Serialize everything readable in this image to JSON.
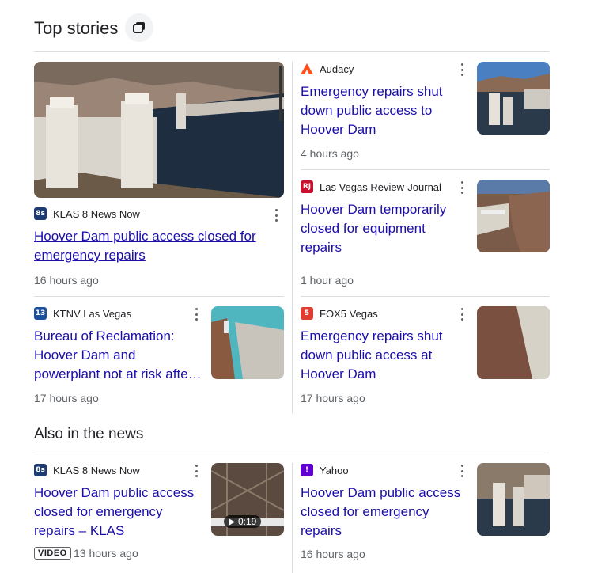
{
  "top_stories": {
    "title": "Top stories",
    "cards": [
      {
        "source": "KLAS 8 News Now",
        "logo_text": "8s",
        "logo_color": "#1f3b73",
        "headline": "Hoover Dam public access closed for emergency repairs",
        "time": "16 hours ago"
      },
      {
        "source": "Audacy",
        "logo_text": "",
        "logo_color": "#ff4f1f",
        "headline": "Emergency repairs shut down public access to Hoover Dam",
        "time": "4 hours ago"
      },
      {
        "source": "Las Vegas Review-Journal",
        "logo_text": "RJ",
        "logo_color": "#c8102e",
        "headline": "Hoover Dam temporarily closed for equipment repairs",
        "time": "1 hour ago"
      },
      {
        "source": "KTNV Las Vegas",
        "logo_text": "13",
        "logo_color": "#1c4f9c",
        "headline": "Bureau of Reclamation: Hoover Dam and powerplant not at risk afte…",
        "time": "17 hours ago"
      },
      {
        "source": "FOX5 Vegas",
        "logo_text": "5",
        "logo_color": "#e03c31",
        "headline": "Emergency repairs shut down public access at Hoover Dam",
        "time": "17 hours ago"
      }
    ]
  },
  "also_in_news": {
    "title": "Also in the news",
    "cards": [
      {
        "source": "KLAS 8 News Now",
        "logo_text": "8s",
        "logo_color": "#1f3b73",
        "headline": "Hoover Dam public access closed for emergency repairs – KLAS",
        "badge": "VIDEO",
        "time": "13 hours ago",
        "duration": "0:19"
      },
      {
        "source": "Yahoo",
        "logo_text": "!",
        "logo_color": "#6001d2",
        "headline": "Hoover Dam public access closed for emergency repairs",
        "time": "16 hours ago"
      }
    ]
  }
}
